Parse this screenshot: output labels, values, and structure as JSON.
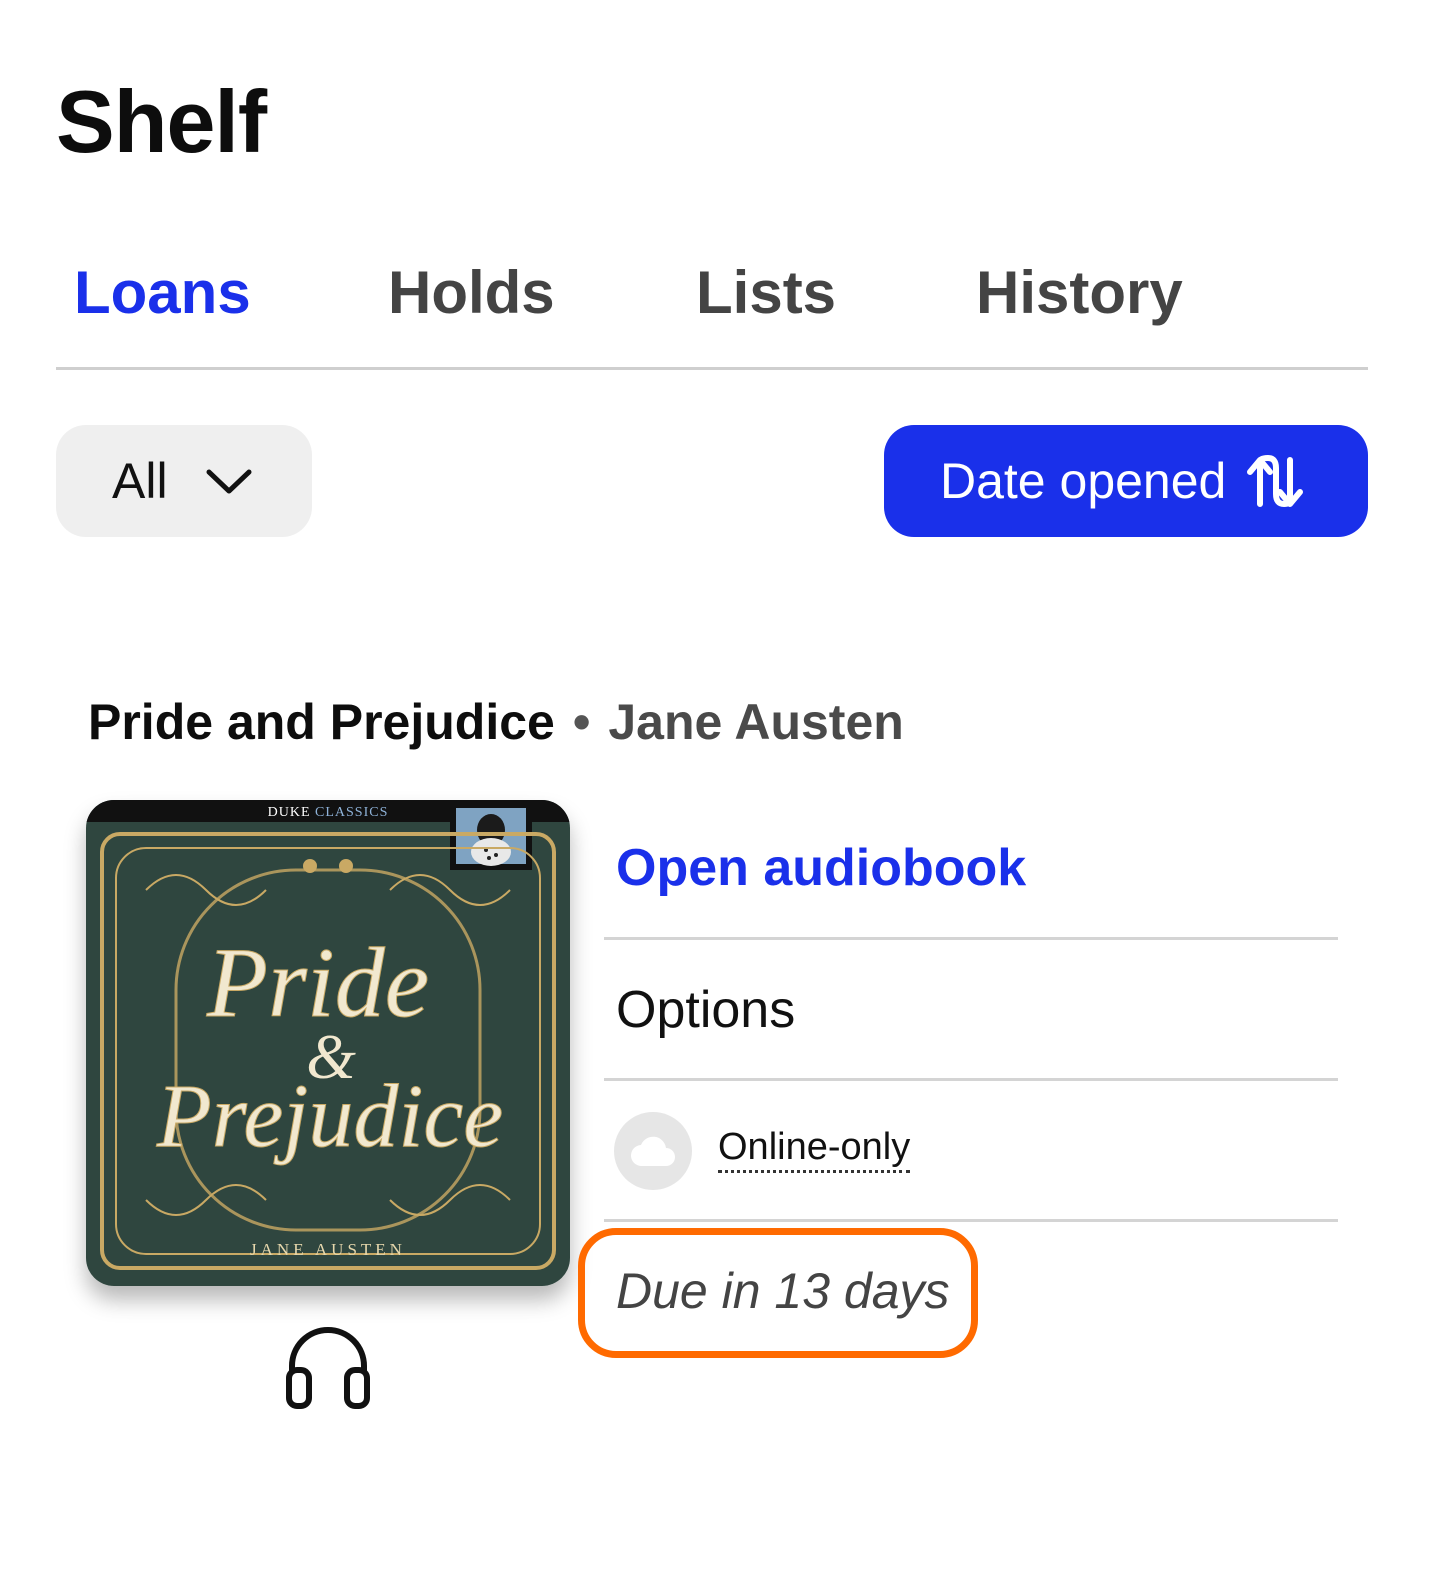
{
  "header": {
    "title": "Shelf"
  },
  "tabs": [
    {
      "label": "Loans",
      "active": true
    },
    {
      "label": "Holds",
      "active": false
    },
    {
      "label": "Lists",
      "active": false
    },
    {
      "label": "History",
      "active": false
    }
  ],
  "toolbar": {
    "filter_label": "All",
    "filter_icon": "chevron-down-icon",
    "sort_label": "Date opened",
    "sort_icon": "sort-arrows-icon"
  },
  "colors": {
    "accent": "#1a30ea",
    "highlight": "#ff6a00",
    "cover_background": "#2f463f",
    "cover_ornament": "#c9a964"
  },
  "loan": {
    "title": "Pride and Prejudice",
    "separator": "•",
    "author": "Jane Austen",
    "cover": {
      "publisher_word1": "DUKE",
      "publisher_word2": "CLASSICS",
      "title_line1": "Pride",
      "ampersand": "&",
      "title_line2": "Prejudice",
      "author": "JANE AUSTEN"
    },
    "format_icon": "headphones-icon",
    "open_label": "Open audiobook",
    "options_label": "Options",
    "availability_icon": "cloud-icon",
    "availability_label": "Online-only",
    "due_label": "Due in 13 days"
  }
}
